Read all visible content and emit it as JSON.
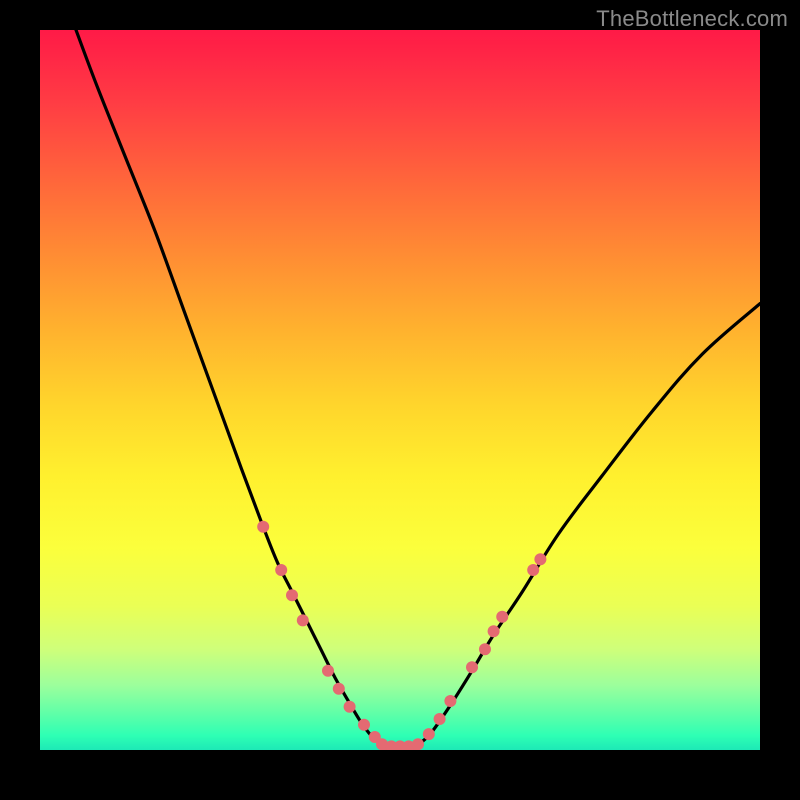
{
  "watermark": "TheBottleneck.com",
  "chart_data": {
    "type": "line",
    "title": "",
    "xlabel": "",
    "ylabel": "",
    "xlim": [
      0,
      100
    ],
    "ylim": [
      0,
      100
    ],
    "grid": false,
    "background_gradient": {
      "top": "#ff1a47",
      "bottom": "#1de9b6"
    },
    "series": [
      {
        "name": "curve-left",
        "stroke": "#000000",
        "x": [
          5,
          8,
          12,
          16,
          20,
          24,
          28,
          31,
          33,
          35,
          37,
          39,
          41,
          43,
          44.5,
          46,
          47.5
        ],
        "y": [
          100,
          92,
          82,
          72,
          61,
          50,
          39,
          31,
          26,
          22,
          18,
          14,
          10,
          6.5,
          4,
          2,
          0.7
        ]
      },
      {
        "name": "curve-right",
        "stroke": "#000000",
        "x": [
          52.5,
          54,
          55.5,
          57.5,
          60,
          63,
          67,
          72,
          78,
          85,
          92,
          100
        ],
        "y": [
          0.7,
          2,
          4,
          7,
          11,
          16,
          22,
          30,
          38,
          47,
          55,
          62
        ]
      },
      {
        "name": "bottom-flat",
        "stroke": "#e46a72",
        "x": [
          47.5,
          48.5,
          50,
          51.5,
          52.5
        ],
        "y": [
          0.7,
          0.5,
          0.5,
          0.5,
          0.7
        ]
      }
    ],
    "markers": {
      "name": "highlight-dots",
      "fill": "#e46a72",
      "radius": 6,
      "points": [
        {
          "x": 31.0,
          "y": 31.0
        },
        {
          "x": 33.5,
          "y": 25.0
        },
        {
          "x": 35.0,
          "y": 21.5
        },
        {
          "x": 36.5,
          "y": 18.0
        },
        {
          "x": 40.0,
          "y": 11.0
        },
        {
          "x": 41.5,
          "y": 8.5
        },
        {
          "x": 43.0,
          "y": 6.0
        },
        {
          "x": 45.0,
          "y": 3.5
        },
        {
          "x": 46.5,
          "y": 1.8
        },
        {
          "x": 47.5,
          "y": 0.8
        },
        {
          "x": 48.8,
          "y": 0.5
        },
        {
          "x": 50.0,
          "y": 0.5
        },
        {
          "x": 51.2,
          "y": 0.5
        },
        {
          "x": 52.5,
          "y": 0.8
        },
        {
          "x": 54.0,
          "y": 2.2
        },
        {
          "x": 55.5,
          "y": 4.3
        },
        {
          "x": 57.0,
          "y": 6.8
        },
        {
          "x": 60.0,
          "y": 11.5
        },
        {
          "x": 61.8,
          "y": 14.0
        },
        {
          "x": 63.0,
          "y": 16.5
        },
        {
          "x": 64.2,
          "y": 18.5
        },
        {
          "x": 68.5,
          "y": 25.0
        },
        {
          "x": 69.5,
          "y": 26.5
        }
      ]
    }
  }
}
